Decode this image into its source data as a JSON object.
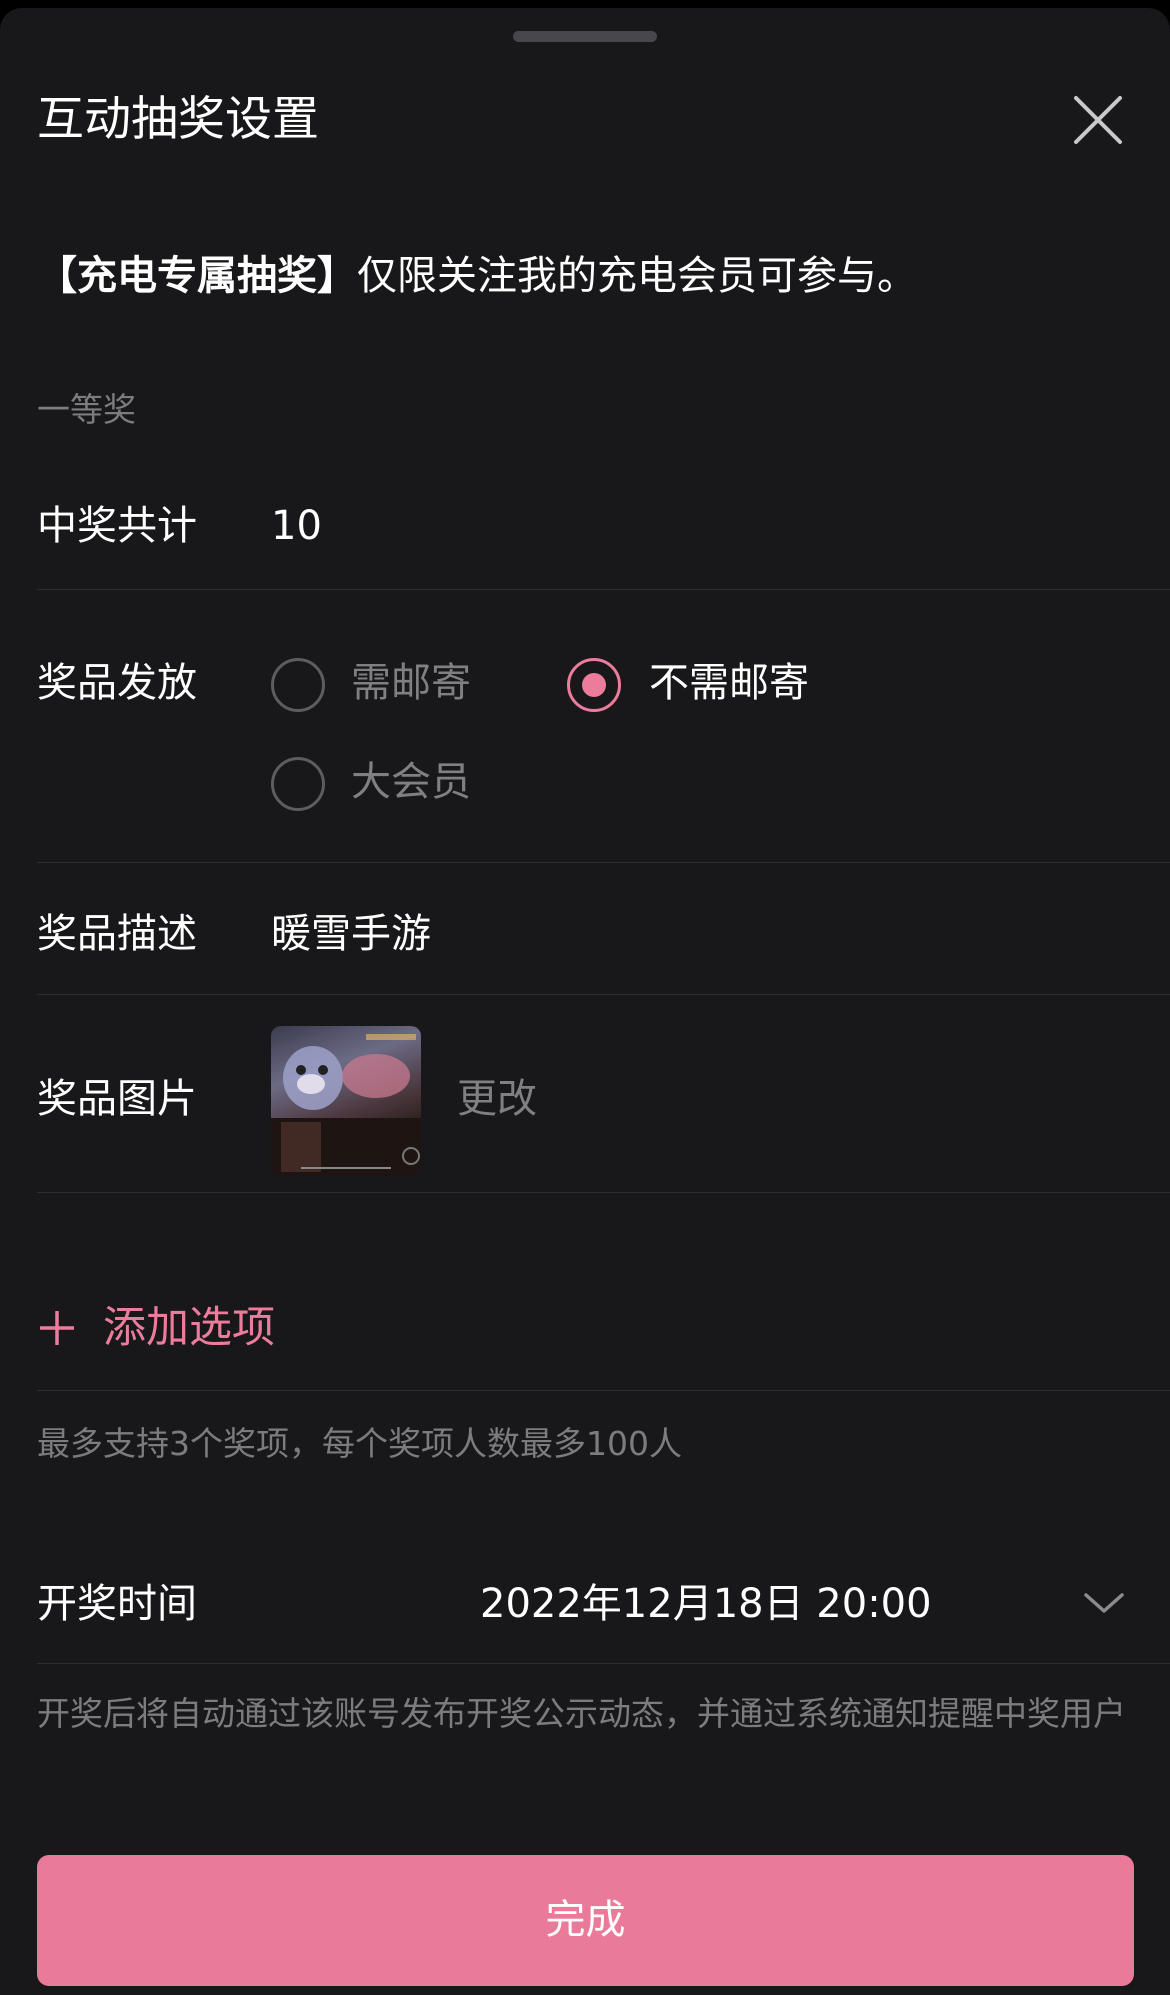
{
  "header": {
    "title": "互动抽奖设置"
  },
  "notice": {
    "bold": "【充电专属抽奖】",
    "text": "仅限关注我的充电会员可参与。"
  },
  "prize": {
    "section_title": "一等奖",
    "count_label": "中奖共计",
    "count_value": "10",
    "delivery_label": "奖品发放",
    "delivery_options": [
      {
        "label": "需邮寄",
        "selected": false
      },
      {
        "label": "不需邮寄",
        "selected": true
      },
      {
        "label": "大会员",
        "selected": false
      }
    ],
    "description_label": "奖品描述",
    "description_value": "暖雪手游",
    "image_label": "奖品图片",
    "change_label": "更改"
  },
  "add_option": {
    "label": "添加选项"
  },
  "limit_hint": "最多支持3个奖项，每个奖项人数最多100人",
  "draw_time": {
    "label": "开奖时间",
    "value": "2022年12月18日 20:00"
  },
  "draw_hint": "开奖后将自动通过该账号发布开奖公示动态，并通过系统通知提醒中奖用户",
  "done_button": "完成",
  "colors": {
    "accent": "#ec7c9c",
    "button": "#ea7a99",
    "background": "#18181a"
  }
}
